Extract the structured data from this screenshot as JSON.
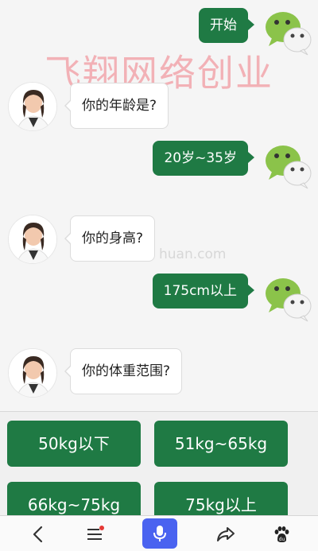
{
  "watermark": "飞翔网络创业",
  "watermark_faint": "huan.com",
  "messages": {
    "user_1": "开始",
    "bot_1": "你的年龄是?",
    "user_2": "20岁~35岁",
    "bot_2": "你的身高?",
    "user_3": "175cm以上",
    "bot_3": "你的体重范围?"
  },
  "options": [
    "50kg以下",
    "51kg~65kg",
    "66kg~75kg",
    "75kg以上"
  ],
  "nav": {
    "icons": [
      "back-chevron-icon",
      "menu-icon",
      "microphone-icon",
      "share-icon",
      "baidu-paw-icon"
    ]
  },
  "colors": {
    "accent_green": "#1f7a44",
    "mic_blue": "#4a63f0",
    "notification_red": "#e53935"
  }
}
